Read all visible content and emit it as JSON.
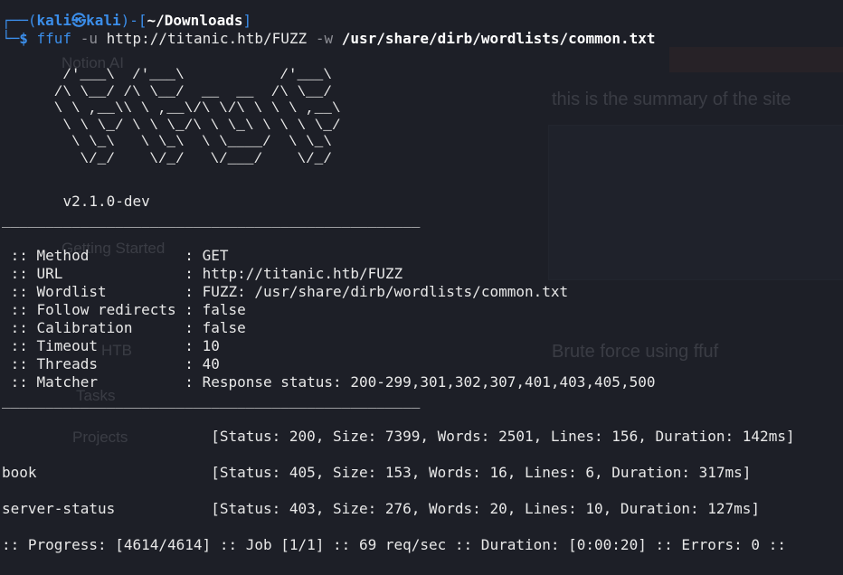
{
  "background_window": {
    "sidebar": [
      "Notion AI",
      "",
      "",
      "",
      "Getting Started",
      "",
      "",
      "HTB",
      "Tasks",
      "Projects"
    ],
    "summary_heading": "this is the summary of the site",
    "brute_heading": "Brute force using ffuf"
  },
  "prompt": {
    "user": "kali",
    "host": "kali",
    "cwd": "~/Downloads",
    "command": "ffuf",
    "args_flag_u": "-u",
    "url": "http://titanic.htb/FUZZ",
    "args_flag_w": "-w",
    "wordlist": "/usr/share/dirb/wordlists/common.txt"
  },
  "banner": "       /'___\\  /'___\\           /'___\\\n      /\\ \\__/ /\\ \\__/  __  __  /\\ \\__/\n      \\ \\ ,__\\\\ \\ ,__\\/\\ \\/\\ \\ \\ \\ ,__\\\n       \\ \\ \\_/ \\ \\ \\_/\\ \\ \\_\\ \\ \\ \\ \\_/\n        \\ \\_\\   \\ \\_\\  \\ \\____/  \\ \\_\\\n         \\/_/    \\/_/   \\/___/    \\/_/",
  "version": "v2.1.0-dev",
  "separator": "________________________________________________",
  "config": [
    {
      "key": " :: Method           : ",
      "value": "GET"
    },
    {
      "key": " :: URL              : ",
      "value": "http://titanic.htb/FUZZ"
    },
    {
      "key": " :: Wordlist         : ",
      "value": "FUZZ: /usr/share/dirb/wordlists/common.txt"
    },
    {
      "key": " :: Follow redirects : ",
      "value": "false"
    },
    {
      "key": " :: Calibration      : ",
      "value": "false"
    },
    {
      "key": " :: Timeout          : ",
      "value": "10"
    },
    {
      "key": " :: Threads          : ",
      "value": "40"
    },
    {
      "key": " :: Matcher          : ",
      "value": "Response status: 200-299,301,302,307,401,403,405,500"
    }
  ],
  "results": [
    {
      "path": "                        ",
      "info": "[Status: 200, Size: 7399, Words: 2501, Lines: 156, Duration: 142ms]"
    },
    {
      "path": "book                    ",
      "info": "[Status: 405, Size: 153, Words: 16, Lines: 6, Duration: 317ms]"
    },
    {
      "path": "server-status           ",
      "info": "[Status: 403, Size: 276, Words: 20, Lines: 10, Duration: 127ms]"
    }
  ],
  "progress": ":: Progress: [4614/4614] :: Job [1/1] :: 69 req/sec :: Duration: [0:00:20] :: Errors: 0 ::"
}
